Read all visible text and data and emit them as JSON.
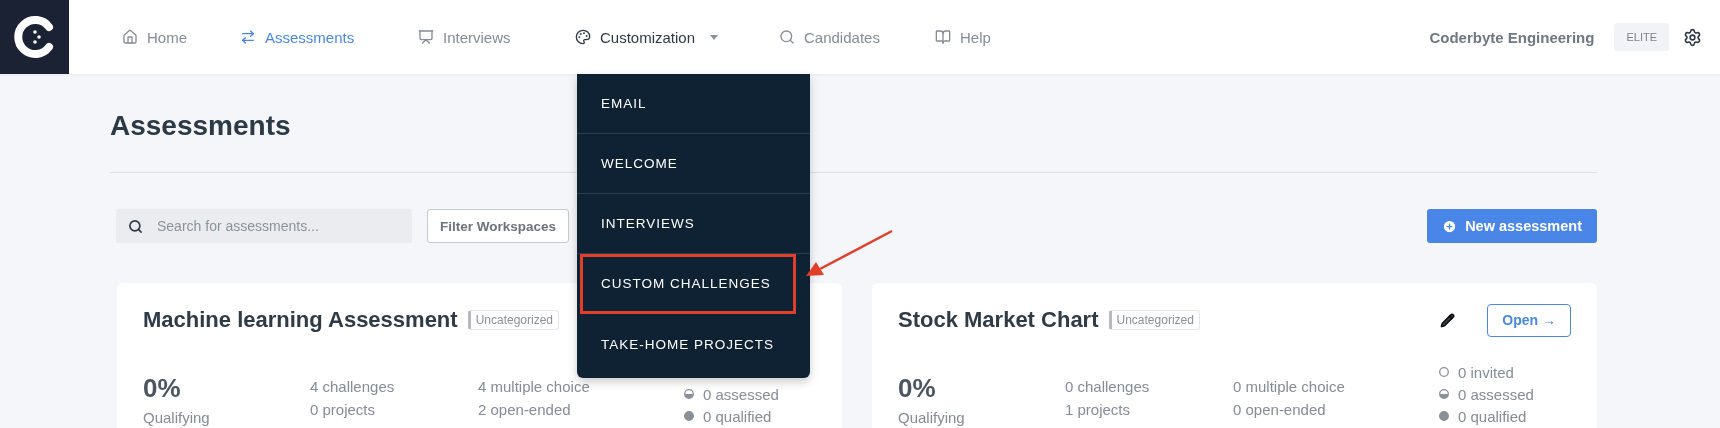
{
  "nav": {
    "items": [
      {
        "label": "Home",
        "selected": false
      },
      {
        "label": "Assessments",
        "selected": true
      },
      {
        "label": "Interviews",
        "selected": false
      },
      {
        "label": "Customization",
        "selected": false,
        "expanded": true
      },
      {
        "label": "Candidates",
        "selected": false
      },
      {
        "label": "Help",
        "selected": false
      }
    ],
    "org": "Coderbyte Engineering",
    "plan": "ELITE"
  },
  "dropdown": {
    "items": [
      {
        "label": "EMAIL",
        "highlighted": false
      },
      {
        "label": "WELCOME",
        "highlighted": false
      },
      {
        "label": "INTERVIEWS",
        "highlighted": false
      },
      {
        "label": "CUSTOM CHALLENGES",
        "highlighted": true
      },
      {
        "label": "TAKE-HOME PROJECTS",
        "highlighted": false
      }
    ]
  },
  "page": {
    "title": "Assessments",
    "search": {
      "placeholder": "Search for assessments..."
    },
    "filter": "Filter Workspaces",
    "new_button": "New assessment"
  },
  "cards": [
    {
      "title": "Machine learning Assessment",
      "tag": "Uncategorized",
      "percent": "0%",
      "percent_label": "Qualifying",
      "counts": [
        "4 challenges",
        "0 projects"
      ],
      "types": [
        "4 multiple choice",
        "2 open-ended"
      ],
      "pipeline": [
        {
          "kind": "assessed",
          "label": "0 assessed"
        },
        {
          "kind": "qualified",
          "label": "0 qualified"
        }
      ]
    },
    {
      "title": "Stock Market Chart",
      "tag": "Uncategorized",
      "open": "Open →",
      "percent": "0%",
      "percent_label": "Qualifying",
      "counts": [
        "0 challenges",
        "1 projects"
      ],
      "types": [
        "0 multiple choice",
        "0 open-ended"
      ],
      "pipeline": [
        {
          "kind": "invited",
          "label": "0 invited"
        },
        {
          "kind": "assessed",
          "label": "0 assessed"
        },
        {
          "kind": "qualified",
          "label": "0 qualified"
        }
      ]
    }
  ]
}
